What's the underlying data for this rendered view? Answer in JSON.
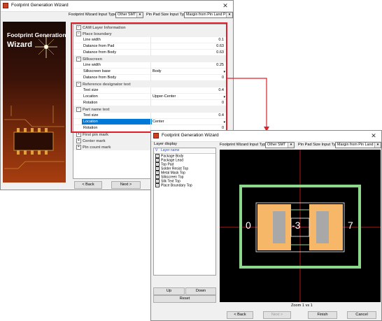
{
  "win1": {
    "title": "Footprint Generation Wizard",
    "close": "✕",
    "banner_line1": "Footprint Generation",
    "banner_line2": "Wizard",
    "input_type_label": "Footprint Wizard Input Type",
    "input_type_value": "Other SMT",
    "pad_size_label": "Pin Pad Size Input Type",
    "pad_size_value": "Margin from Pin Land Patt",
    "root": "CAM Layer Information",
    "place_boundary": "Place boundary",
    "line_width_label": "Line width",
    "line_width_value": "0.1",
    "datance_pad_label": "Datance from Pad",
    "datance_pad_value": "0.63",
    "datance_body_label": "Datance from Body",
    "datance_body_value": "0.63",
    "silkscreen": "Silkscreen",
    "silk_line_width_label": "Line width",
    "silk_line_width_value": "0.25",
    "silk_base_label": "Silkscreen base",
    "silk_base_value": "Body",
    "silk_datance_body_label": "Datance from Body",
    "silk_datance_body_value": "0",
    "refdes": "Reference designator text",
    "ref_text_size_label": "Text size",
    "ref_text_size_value": "0.4",
    "ref_location_label": "Location",
    "ref_location_value": "Upper-Center",
    "ref_rotation_label": "Rotation",
    "ref_rotation_value": "0",
    "part_name": "Part name text",
    "pn_text_size_label": "Text size",
    "pn_text_size_value": "0.4",
    "pn_location_label": "Location",
    "pn_location_value": "Center",
    "pn_rotation_label": "Rotation",
    "pn_rotation_value": "0",
    "first_pin": "First pin mark",
    "center_mark": "Center mark",
    "pin_count": "Pin count mark",
    "back": "< Back",
    "next": "Next >"
  },
  "win2": {
    "title": "Footprint Generation Wizard",
    "close": "✕",
    "layer_display": "Layer display",
    "col_v": "V",
    "col_name": "Layer name",
    "layers": [
      "Package Body",
      "Package Lead",
      "Top Pad",
      "Solder Resist Top",
      "Metal Mask Top",
      "Silkscreen Top",
      "Silk Text Top",
      "Place Boundary Top"
    ],
    "check": "✓",
    "up": "Up",
    "down": "Down",
    "reset": "Reset",
    "input_type_label": "Footprint Wizard Input Type",
    "input_type_value": "Other SMT",
    "pad_size_label": "Pin Pad Size Input Type",
    "pad_size_value": "Margin from Pin Land Patt",
    "pin_left": "0",
    "pin_center": "-3",
    "pin_right": "7",
    "zoom": "Zoom 1 vs 1",
    "back": "< Back",
    "next": "Next >",
    "finish": "Finish",
    "cancel": "Cancel"
  },
  "colors": {
    "highlight_box": "#e0202a",
    "selection": "#0078d7",
    "pad": "#f6b868",
    "body": "#a8a8a8",
    "boundary": "#8ed88e",
    "canvas": "#000000"
  }
}
